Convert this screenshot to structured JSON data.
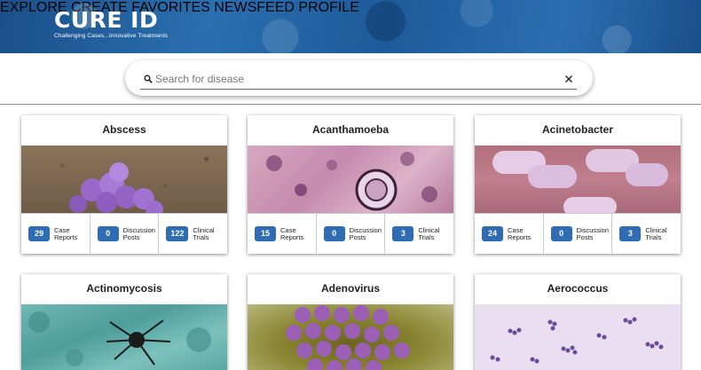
{
  "header": {
    "logo_main": "CURE ID",
    "logo_tagline": "Challenging Cases...Innovative Treatments",
    "nav": [
      "EXPLORE",
      "CREATE",
      "FAVORITES",
      "NEWSFEED",
      "PROFILE"
    ]
  },
  "search": {
    "placeholder": "Search for disease"
  },
  "icons": {
    "search": "search-icon",
    "clear": "close-icon"
  },
  "colors": {
    "badge": "#2e6db4",
    "header": "#1d5a99"
  },
  "stat_labels": {
    "case_reports": "Case Reports",
    "discussion_posts": "Discussion Posts",
    "clinical_trials": "Clinical Trials"
  },
  "cards": [
    {
      "title": "Abscess",
      "case_reports": "29",
      "discussion_posts": "0",
      "clinical_trials": "122"
    },
    {
      "title": "Acanthamoeba",
      "case_reports": "15",
      "discussion_posts": "0",
      "clinical_trials": "3"
    },
    {
      "title": "Acinetobacter",
      "case_reports": "24",
      "discussion_posts": "0",
      "clinical_trials": "3"
    },
    {
      "title": "Actinomycosis"
    },
    {
      "title": "Adenovirus"
    },
    {
      "title": "Aerococcus"
    }
  ]
}
